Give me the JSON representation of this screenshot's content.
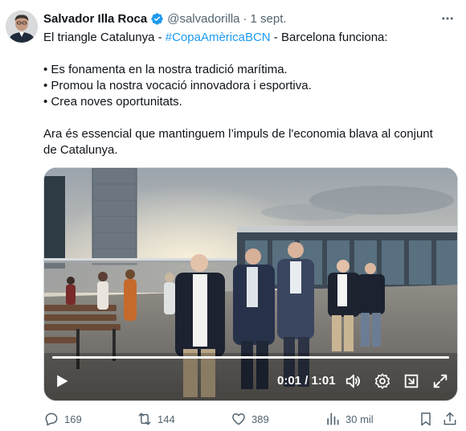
{
  "author": {
    "name": "Salvador Illa Roca",
    "handle": "@salvadorilla",
    "separator": "·",
    "date": "1 sept."
  },
  "icons": {
    "verified": "verified-badge-icon",
    "more": "more-icon",
    "play": "play-icon",
    "volume": "volume-icon",
    "settings": "settings-icon",
    "pip": "pip-icon",
    "fullscreen": "fullscreen-icon"
  },
  "tweet": {
    "line1_prefix": "El triangle Catalunya - ",
    "line1_hashtag": "#CopaAmèricaBCN",
    "line1_suffix": " - Barcelona funciona:",
    "bullet1": "• Es fonamenta en la nostra tradició marítima.",
    "bullet2": "• Promou la nostra vocació innovadora i esportiva.",
    "bullet3": "• Crea noves oportunitats.",
    "para2_line1": "Ara és essencial que mantinguem l’impuls de l'economia blava al conjunt",
    "para2_line2": "de Catalunya."
  },
  "video": {
    "time": "0:01 / 1:01",
    "progress": 1.0
  },
  "actions": {
    "replies": "169",
    "reposts": "144",
    "likes": "389",
    "views": "30 mil"
  },
  "colors": {
    "link": "#1d9bf0",
    "secondary_text": "#536471",
    "verified": "#1d9bf0"
  }
}
